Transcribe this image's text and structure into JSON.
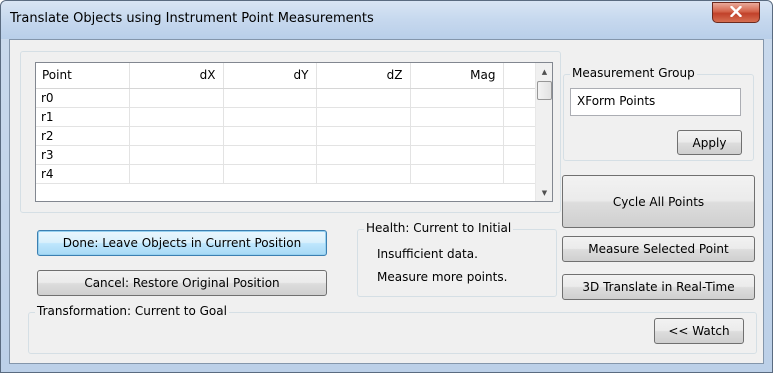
{
  "window": {
    "title": "Translate Objects using Instrument Point Measurements",
    "close_glyph": "✕"
  },
  "grid": {
    "headers": [
      "Point",
      "dX",
      "dY",
      "dZ",
      "Mag"
    ],
    "rows": [
      [
        "r0",
        "",
        "",
        "",
        ""
      ],
      [
        "r1",
        "",
        "",
        "",
        ""
      ],
      [
        "r2",
        "",
        "",
        "",
        ""
      ],
      [
        "r3",
        "",
        "",
        "",
        ""
      ],
      [
        "r4",
        "",
        "",
        "",
        ""
      ]
    ],
    "scroll_up_glyph": "▲",
    "scroll_down_glyph": "▼"
  },
  "measurement_group": {
    "label": "Measurement Group",
    "value": "XForm Points",
    "apply_label": "Apply"
  },
  "buttons": {
    "cycle_all": "Cycle All Points",
    "done": "Done: Leave Objects in Current Position",
    "cancel": "Cancel: Restore Original Position",
    "measure_selected": "Measure Selected Point",
    "translate_realtime": "3D Translate in Real-Time",
    "watch": "<< Watch"
  },
  "health": {
    "label": "Health: Current to Initial",
    "line1": "Insufficient data.",
    "line2": "Measure more points."
  },
  "transformation": {
    "label": "Transformation:  Current to Goal"
  }
}
